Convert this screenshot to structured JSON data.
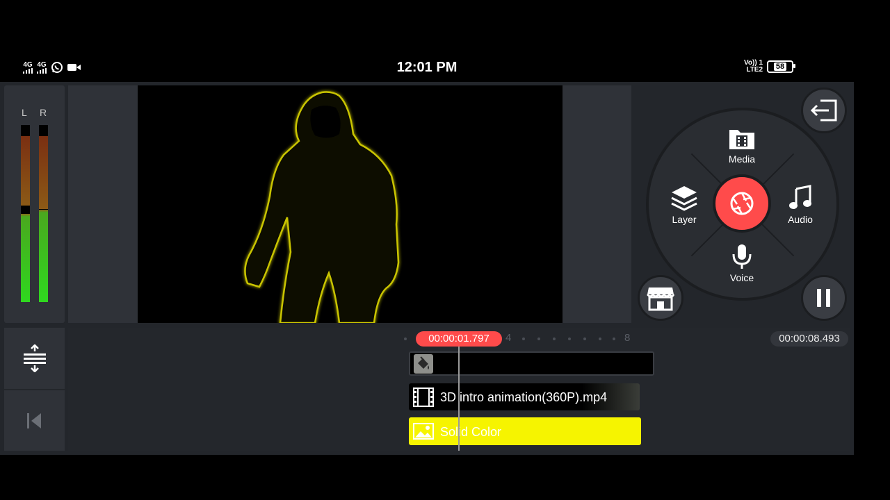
{
  "status_bar": {
    "left_signal_1": "4G",
    "left_signal_2": "4G",
    "time": "12:01 PM",
    "volte_line1": "Vo)) 1",
    "volte_line2": "LTE2",
    "battery": "58"
  },
  "meter": {
    "left_label": "L",
    "right_label": "R",
    "left_level": 0.5,
    "right_level": 0.52
  },
  "radial_menu": {
    "media": "Media",
    "audio": "Audio",
    "voice": "Voice",
    "layer": "Layer"
  },
  "timeline": {
    "current_time": "00:00:01.797",
    "total_time": "00:00:08.493",
    "tick_4": "4",
    "tick_8": "8",
    "tracks": {
      "video_label": "3D intro animation(360P).mp4",
      "color_label": "Solid Color"
    }
  },
  "colors": {
    "record": "#ff4b4b",
    "solid_color_track": "#f6f400",
    "accent_time": "#ff4b4b"
  },
  "icons": {
    "exit": "exit-icon",
    "store": "store-icon",
    "pause": "pause-icon",
    "camera": "camera-shutter-icon",
    "media": "media-folder-icon",
    "audio": "music-note-icon",
    "voice": "microphone-icon",
    "layer": "layers-icon",
    "split": "split-timeline-icon",
    "rewind": "skip-to-start-icon",
    "paint": "paint-bucket-icon",
    "film": "film-icon",
    "image": "image-icon"
  }
}
